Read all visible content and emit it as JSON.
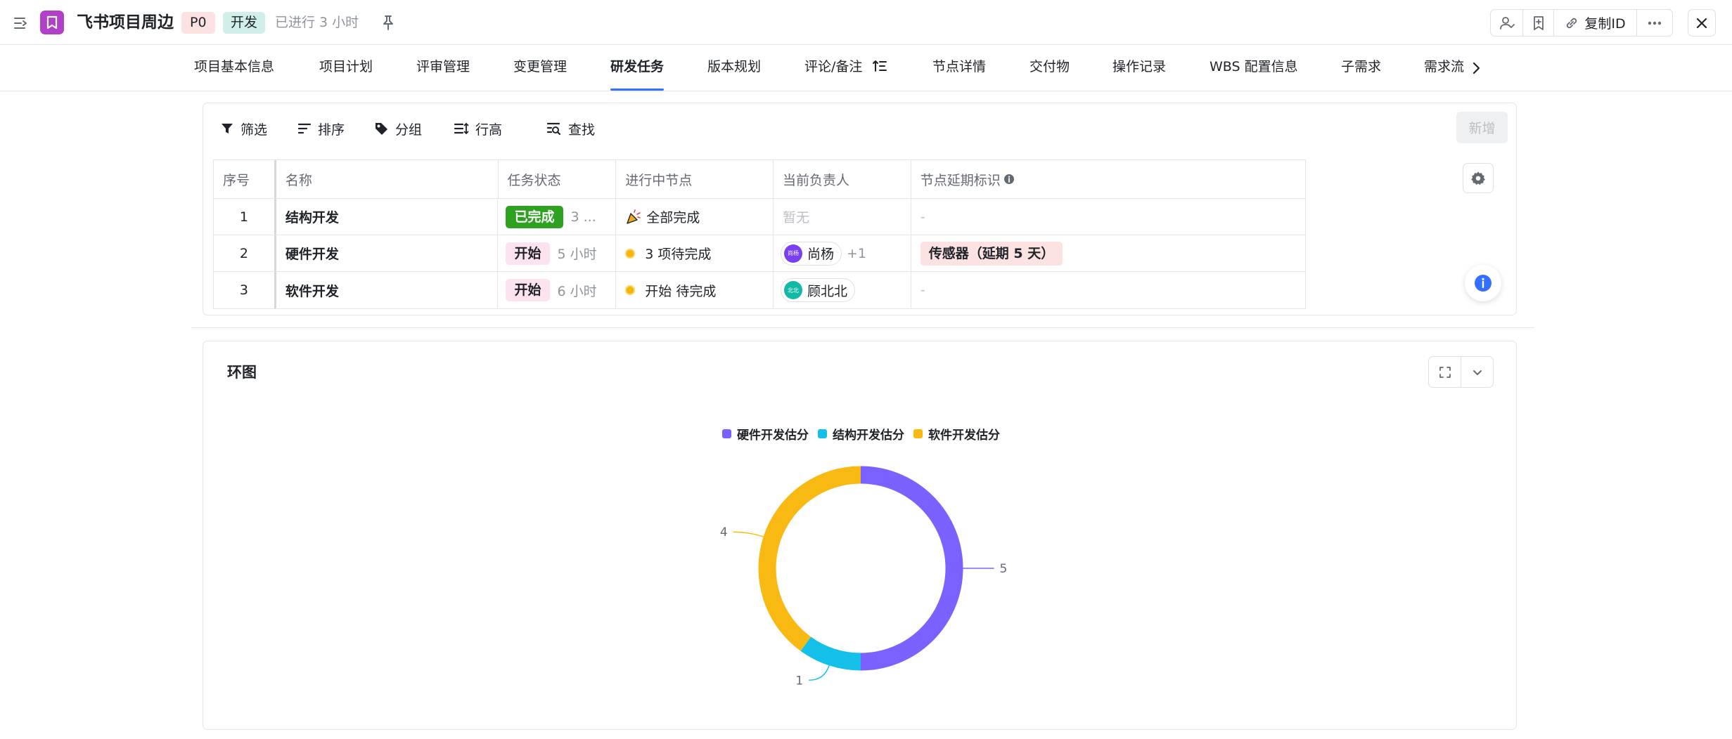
{
  "header": {
    "title": "飞书项目周边",
    "priority": "P0",
    "stage": "开发",
    "elapsed": "已进行 3 小时",
    "copy_id_label": "复制ID",
    "app_color": "#b140c9"
  },
  "tabs": [
    {
      "label": "项目基本信息"
    },
    {
      "label": "项目计划"
    },
    {
      "label": "评审管理"
    },
    {
      "label": "变更管理"
    },
    {
      "label": "研发任务",
      "active": true
    },
    {
      "label": "版本规划"
    },
    {
      "label": "评论/备注"
    },
    {
      "label": "节点详情"
    },
    {
      "label": "交付物"
    },
    {
      "label": "操作记录"
    },
    {
      "label": "WBS 配置信息"
    },
    {
      "label": "子需求"
    },
    {
      "label": "需求流"
    }
  ],
  "toolbar": {
    "filter": "筛选",
    "sort": "排序",
    "group": "分组",
    "row_height": "行高",
    "find": "查找",
    "add": "新增"
  },
  "table": {
    "columns": [
      "序号",
      "名称",
      "任务状态",
      "进行中节点",
      "当前负责人",
      "节点延期标识"
    ],
    "rows": [
      {
        "index": "1",
        "name": "结构开发",
        "status": "已完成",
        "duration": "3 ...",
        "node": "全部完成",
        "owner": "暂无",
        "delay": "-"
      },
      {
        "index": "2",
        "name": "硬件开发",
        "status": "开始",
        "duration": "5 小时",
        "node": "3 项待完成",
        "owner": "尚杨",
        "owner_avatar": "尚杨",
        "owner_extra": "+1",
        "delay": "传感器（延期 5 天）"
      },
      {
        "index": "3",
        "name": "软件开发",
        "status": "开始",
        "duration": "6 小时",
        "node": "开始 待完成",
        "owner": "顾北北",
        "owner_avatar": "北北",
        "delay": "-"
      }
    ]
  },
  "chart_panel": {
    "title": "环图"
  },
  "chart_data": {
    "type": "pie",
    "variant": "donut",
    "categories": [
      "硬件开发估分",
      "结构开发估分",
      "软件开发估分"
    ],
    "values": [
      5,
      1,
      4
    ],
    "colors": [
      "#7b61ff",
      "#14c0e8",
      "#f8b912"
    ],
    "legend": "top-center"
  }
}
